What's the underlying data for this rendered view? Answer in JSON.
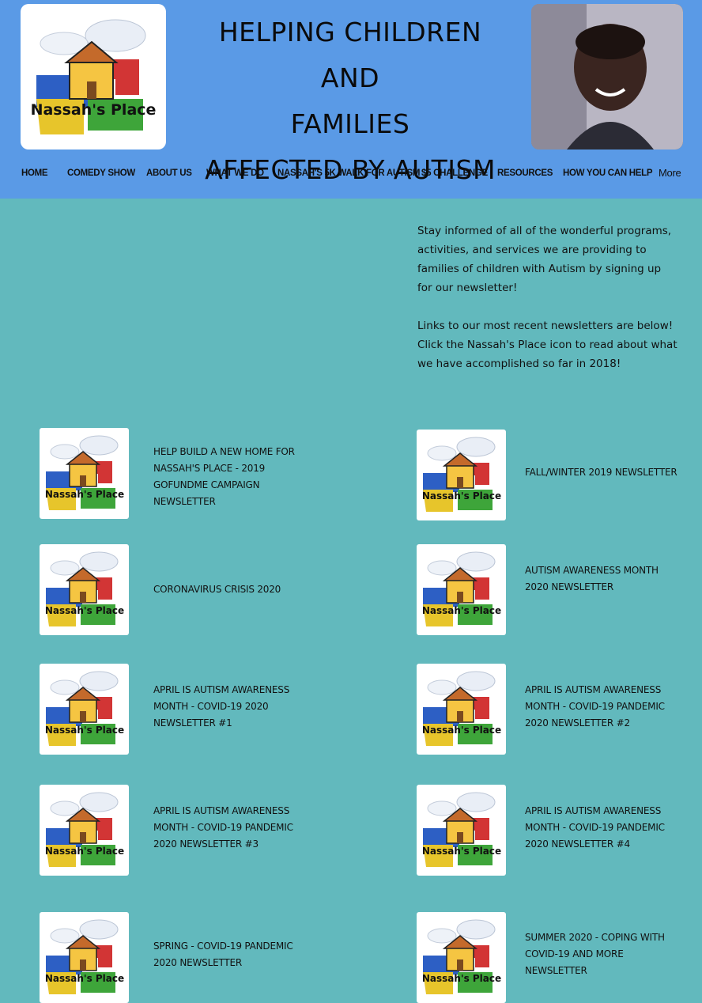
{
  "header": {
    "title_lines": [
      "HELPING CHILDREN AND",
      "FAMILIES",
      "AFFECTED BY AUTISM"
    ],
    "logo_text": "Nassah's Place",
    "photo_alt": "Nassah portrait"
  },
  "nav": {
    "items": [
      {
        "label": "HOME"
      },
      {
        "label": "COMEDY SHOW"
      },
      {
        "label": "ABOUT US"
      },
      {
        "label": "WHAT WE DO"
      },
      {
        "label": "NASSAH'S 5K WALK FOR AUTISM"
      },
      {
        "label": "$5 CHALLENGE"
      },
      {
        "label": "RESOURCES"
      },
      {
        "label": "HOW YOU CAN HELP"
      },
      {
        "label": "More"
      }
    ]
  },
  "intro": {
    "paragraph1": "Stay informed of all of the wonderful programs, activities, and services we are providing to families of children with Autism by signing up for our newsletter!",
    "paragraph2": "Links to our most recent newsletters are below! Click the Nassah's Place icon to read about what we have accomplished so far in 2018!"
  },
  "newsletters": [
    {
      "label": "HELP BUILD A NEW HOME FOR NASSAH'S PLACE - 2019 GOFUNDME CAMPAIGN NEWSLETTER"
    },
    {
      "label": "FALL/WINTER 2019 NEWSLETTER"
    },
    {
      "label": "CORONAVIRUS CRISIS 2020"
    },
    {
      "label": "AUTISM AWARENESS MONTH 2020 NEWSLETTER"
    },
    {
      "label": "APRIL IS AUTISM AWARENESS MONTH - COVID-19 2020 NEWSLETTER #1"
    },
    {
      "label": "APRIL IS AUTISM AWARENESS MONTH - COVID-19 PANDEMIC 2020 NEWSLETTER #2"
    },
    {
      "label": "APRIL IS AUTISM AWARENESS MONTH - COVID-19 PANDEMIC 2020 NEWSLETTER #3"
    },
    {
      "label": "APRIL IS AUTISM AWARENESS MONTH - COVID-19 PANDEMIC 2020 NEWSLETTER #4"
    },
    {
      "label": "SPRING - COVID-19 PANDEMIC 2020 NEWSLETTER"
    },
    {
      "label": "SUMMER 2020 - COPING WITH COVID-19 AND MORE NEWSLETTER"
    }
  ],
  "colors": {
    "header_bg": "#5a9ae6",
    "page_bg": "#62b9bd"
  }
}
